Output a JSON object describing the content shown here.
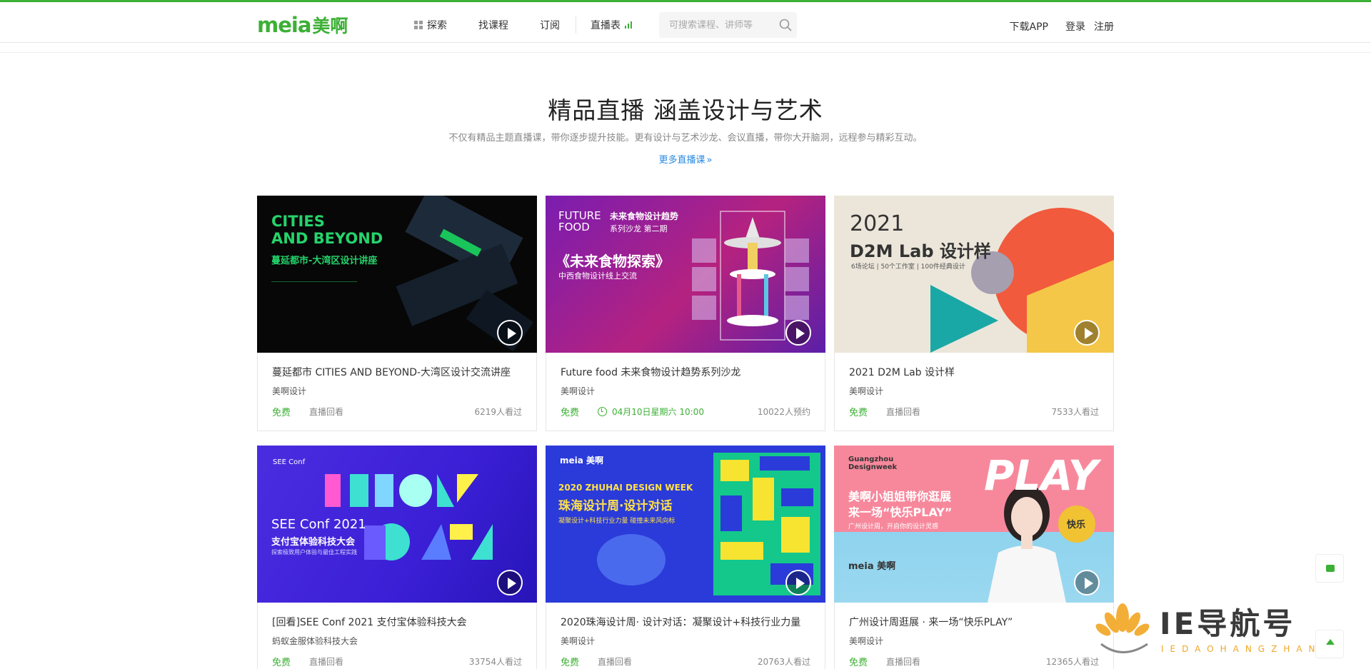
{
  "header": {
    "logo_en": "meia",
    "logo_cn": "美啊",
    "nav": [
      {
        "label": "探索"
      },
      {
        "label": "找课程"
      },
      {
        "label": "订阅"
      },
      {
        "label": "直播表"
      }
    ],
    "search_placeholder": "可搜索课程、讲师等",
    "download_app": "下载APP",
    "login": "登录",
    "register": "注册",
    "accent_color": "#3cb035"
  },
  "hero": {
    "title": "精品直播 涵盖设计与艺术",
    "subtitle": "不仅有精品主题直播课，带你逐步提升技能。更有设计与艺术沙龙、会议直播，带你大开脑洞，远程参与精彩互动。",
    "more_link": "更多直播课",
    "more_chevron": "»"
  },
  "cards": [
    {
      "thumb_texts": [
        "CITIES",
        "AND BEYOND",
        "蔓延都市-大湾区设计讲座"
      ],
      "title": "蔓延都市 CITIES AND BEYOND-大湾区设计交流讲座",
      "org": "美啊设计",
      "price": "免费",
      "status": "直播回看",
      "count": "6219人看过"
    },
    {
      "thumb_texts": [
        "FUTURE",
        "FOOD",
        "未来食物设计趋势",
        "系列沙龙 第二期",
        "《未来食物探索》",
        "中西食物设计线上交流"
      ],
      "title": "Future food 未来食物设计趋势系列沙龙",
      "org": "美啊设计",
      "price": "免费",
      "status": "04月10日星期六 10:00",
      "count": "10022人预约"
    },
    {
      "thumb_texts": [
        "2021",
        "D2M Lab 设计样",
        "6场论坛 | 50个工作室 | 100件经典设计"
      ],
      "title": "2021 D2M Lab 设计样",
      "org": "美啊设计",
      "price": "免费",
      "status": "直播回看",
      "count": "7533人看过"
    },
    {
      "thumb_texts": [
        "SEE Conf 2021",
        "支付宝体验科技大会",
        "探索极致用户体验与最佳工程实践"
      ],
      "title": "[回看]SEE Conf 2021 支付宝体验科技大会",
      "org": "蚂蚁金服体验科技大会",
      "price": "免费",
      "status": "直播回看",
      "count": "33754人看过"
    },
    {
      "thumb_texts": [
        "meia 美啊",
        "2020 ZHUHAI DESIGN WEEK",
        "珠海设计周·设计对话",
        "凝聚设计+科技行业力量 碰撞未来风向标"
      ],
      "title": "2020珠海设计周· 设计对话：凝聚设计+科技行业力量",
      "org": "美啊设计",
      "price": "免费",
      "status": "直播回看",
      "count": "20763人看过"
    },
    {
      "thumb_texts": [
        "Guangzhou",
        "Designweek",
        "PLAY",
        "美啊小姐姐带你逛展",
        "来一场“快乐PLAY”",
        "广州设计周，开启你的设计灵感",
        "快乐"
      ],
      "title": "广州设计周逛展 · 来一场“快乐PLAY”",
      "org": "美啊设计",
      "price": "免费",
      "status": "直播回看",
      "count": "12365人看过"
    }
  ],
  "watermark": {
    "text": "IE导航号",
    "sub": "IEDAOHANGZHAN"
  }
}
